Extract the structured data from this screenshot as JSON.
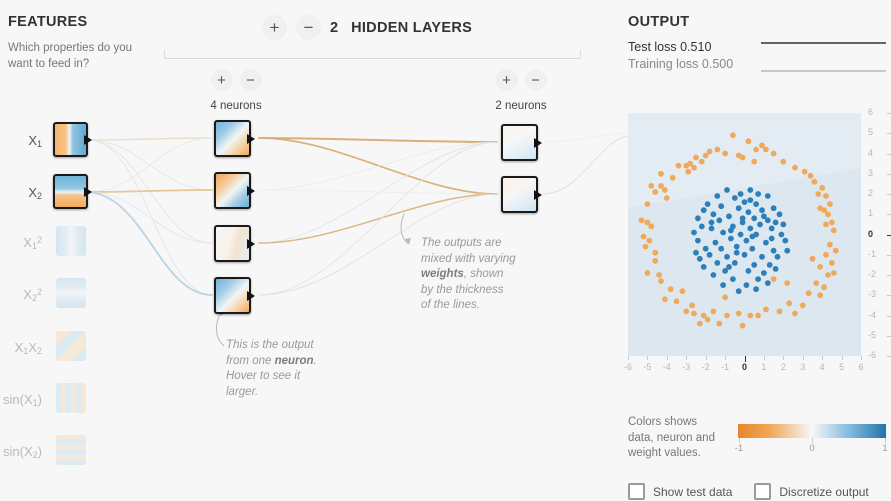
{
  "features": {
    "title": "FEATURES",
    "subtitle": "Which properties do you want to feed in?",
    "items": [
      {
        "label_html": "X₁",
        "base": "X",
        "sub": "1",
        "sup": "",
        "active": true,
        "name": "feature-x1"
      },
      {
        "label_html": "X₂",
        "base": "X",
        "sub": "2",
        "sup": "",
        "active": true,
        "name": "feature-x2"
      },
      {
        "label_html": "X₁²",
        "base": "X",
        "sub": "1",
        "sup": "2",
        "active": false,
        "name": "feature-x1-squared"
      },
      {
        "label_html": "X₂²",
        "base": "X",
        "sub": "2",
        "sup": "2",
        "active": false,
        "name": "feature-x2-squared"
      },
      {
        "label_html": "X₁X₂",
        "base": "X1X2",
        "sub": "",
        "sup": "",
        "active": false,
        "name": "feature-x1x2"
      },
      {
        "label_html": "sin(X₁)",
        "base": "sin(X",
        "sub": "1",
        "sup": "",
        "active": false,
        "name": "feature-sin-x1"
      },
      {
        "label_html": "sin(X₂)",
        "base": "sin(X",
        "sub": "2",
        "sup": "",
        "active": false,
        "name": "feature-sin-x2"
      }
    ]
  },
  "hidden_layers": {
    "count": "2",
    "title": "HIDDEN LAYERS",
    "add_label": "+",
    "remove_label": "−",
    "layers": [
      {
        "neuron_count_label": "4 neurons",
        "neurons": 4,
        "add_label": "+",
        "remove_label": "−"
      },
      {
        "neuron_count_label": "2 neurons",
        "neurons": 2,
        "add_label": "+",
        "remove_label": "−"
      }
    ]
  },
  "annotations": {
    "neuron": {
      "line1": "This is the output",
      "line2a": "from one ",
      "line2b": "neuron",
      "line2c": ".",
      "line3": "Hover to see it",
      "line4": "larger."
    },
    "weights": {
      "line1": "The outputs are",
      "line2": "mixed with varying",
      "line3a": "weights",
      "line3b": ", shown",
      "line4": "by the thickness",
      "line5": "of the lines."
    }
  },
  "output": {
    "title": "OUTPUT",
    "test_loss_label": "Test loss",
    "test_loss_value": "0.510",
    "training_loss_label": "Training loss",
    "training_loss_value": "0.500"
  },
  "legend": {
    "line1": "Colors shows",
    "line2": "data, neuron and",
    "line3": "weight values.",
    "ticks": [
      "-1",
      "0",
      "1"
    ]
  },
  "controls": {
    "show_test_data": "Show test data",
    "discretize_output": "Discretize output",
    "show_test_data_checked": false,
    "discretize_output_checked": false
  },
  "colors": {
    "negative": "#e8852a",
    "positive": "#2173a8",
    "neutral": "#f7f7f7",
    "plot_background": "#dce7ef",
    "text": "#333333",
    "muted": "#999999"
  },
  "chart_data": {
    "type": "scatter",
    "title": "OUTPUT",
    "xlabel": "",
    "ylabel": "",
    "xlim": [
      -6,
      6
    ],
    "ylim": [
      -6,
      6
    ],
    "xticks": [
      -6,
      -5,
      -4,
      -3,
      -2,
      -1,
      0,
      1,
      2,
      3,
      4,
      5,
      6
    ],
    "yticks": [
      -6,
      -5,
      -4,
      -3,
      -2,
      -1,
      0,
      1,
      2,
      3,
      4,
      5,
      6
    ],
    "grid": false,
    "legend": "none",
    "series": [
      {
        "name": "negative (orange ring)",
        "color": "#f0a95a",
        "points": [
          [
            -0.6,
            4.9
          ],
          [
            0.2,
            4.6
          ],
          [
            0.9,
            4.4
          ],
          [
            -1.8,
            4.1
          ],
          [
            -1.4,
            4.2
          ],
          [
            -1.0,
            4.0
          ],
          [
            -2.5,
            3.8
          ],
          [
            1.5,
            4.0
          ],
          [
            -0.3,
            3.9
          ],
          [
            -0.1,
            3.8
          ],
          [
            0.5,
            3.6
          ],
          [
            2.0,
            3.6
          ],
          [
            2.6,
            3.3
          ],
          [
            -3.4,
            3.4
          ],
          [
            -3.0,
            3.4
          ],
          [
            -2.8,
            3.5
          ],
          [
            -2.6,
            3.3
          ],
          [
            -2.9,
            3.1
          ],
          [
            -4.3,
            3.0
          ],
          [
            3.1,
            3.1
          ],
          [
            3.4,
            2.9
          ],
          [
            3.6,
            2.6
          ],
          [
            -4.8,
            2.4
          ],
          [
            -4.3,
            2.4
          ],
          [
            -4.1,
            2.2
          ],
          [
            -4.6,
            2.1
          ],
          [
            4.0,
            2.3
          ],
          [
            3.8,
            2.0
          ],
          [
            4.2,
            1.9
          ],
          [
            -5.0,
            1.5
          ],
          [
            4.4,
            1.5
          ],
          [
            3.9,
            1.3
          ],
          [
            4.1,
            1.2
          ],
          [
            4.3,
            1.0
          ],
          [
            -5.3,
            0.7
          ],
          [
            -5.0,
            0.6
          ],
          [
            -4.8,
            0.4
          ],
          [
            4.5,
            0.6
          ],
          [
            4.2,
            0.5
          ],
          [
            4.6,
            0.2
          ],
          [
            -5.2,
            -0.1
          ],
          [
            -4.9,
            -0.3
          ],
          [
            -5.1,
            -0.6
          ],
          [
            4.4,
            -0.5
          ],
          [
            4.7,
            -0.8
          ],
          [
            4.2,
            -1.0
          ],
          [
            -4.6,
            -1.3
          ],
          [
            4.5,
            -1.4
          ],
          [
            3.9,
            -1.6
          ],
          [
            -5.0,
            -1.9
          ],
          [
            4.3,
            -2.0
          ],
          [
            -4.3,
            -2.3
          ],
          [
            1.5,
            -2.2
          ],
          [
            2.2,
            -2.4
          ],
          [
            3.7,
            -2.4
          ],
          [
            4.1,
            -2.6
          ],
          [
            -3.8,
            -2.7
          ],
          [
            -3.2,
            -2.8
          ],
          [
            3.3,
            -2.9
          ],
          [
            3.9,
            -3.0
          ],
          [
            -4.1,
            -3.2
          ],
          [
            -3.5,
            -3.3
          ],
          [
            -1.0,
            -3.1
          ],
          [
            -2.7,
            -3.5
          ],
          [
            2.3,
            -3.4
          ],
          [
            3.0,
            -3.5
          ],
          [
            -3.0,
            -3.8
          ],
          [
            -2.6,
            -3.9
          ],
          [
            -1.6,
            -3.8
          ],
          [
            1.1,
            -3.7
          ],
          [
            1.8,
            -3.8
          ],
          [
            2.6,
            -3.9
          ],
          [
            -2.1,
            -4.0
          ],
          [
            -0.9,
            -4.0
          ],
          [
            -0.3,
            -3.9
          ],
          [
            0.3,
            -4.0
          ],
          [
            0.7,
            -4.0
          ],
          [
            -1.9,
            -4.2
          ],
          [
            -1.3,
            -4.4
          ],
          [
            -0.1,
            -4.5
          ],
          [
            -2.3,
            -4.4
          ],
          [
            -4.6,
            -0.9
          ],
          [
            -4.4,
            -2.0
          ],
          [
            -2.0,
            3.9
          ],
          [
            -3.7,
            2.8
          ],
          [
            3.5,
            -1.2
          ],
          [
            1.1,
            4.2
          ],
          [
            -2.2,
            3.6
          ],
          [
            0.6,
            4.2
          ],
          [
            -4.0,
            1.8
          ],
          [
            4.6,
            -1.9
          ]
        ]
      },
      {
        "name": "positive (blue center)",
        "color": "#2c7fb8",
        "points": [
          [
            -0.9,
            2.2
          ],
          [
            0.3,
            2.2
          ],
          [
            -1.4,
            1.9
          ],
          [
            1.2,
            1.9
          ],
          [
            -0.5,
            1.8
          ],
          [
            -1.9,
            1.5
          ],
          [
            0.0,
            1.6
          ],
          [
            0.6,
            1.5
          ],
          [
            -1.2,
            1.4
          ],
          [
            1.5,
            1.3
          ],
          [
            -2.1,
            1.2
          ],
          [
            -0.3,
            1.3
          ],
          [
            0.9,
            1.2
          ],
          [
            -1.6,
            1.0
          ],
          [
            0.2,
            1.1
          ],
          [
            1.8,
            1.0
          ],
          [
            -2.4,
            0.8
          ],
          [
            -0.8,
            0.9
          ],
          [
            0.5,
            0.8
          ],
          [
            1.2,
            0.7
          ],
          [
            -1.3,
            0.7
          ],
          [
            -0.1,
            0.6
          ],
          [
            0.8,
            0.5
          ],
          [
            2.0,
            0.5
          ],
          [
            -2.2,
            0.4
          ],
          [
            -1.7,
            0.3
          ],
          [
            -0.6,
            0.4
          ],
          [
            0.3,
            0.3
          ],
          [
            1.4,
            0.3
          ],
          [
            -2.6,
            0.1
          ],
          [
            -1.1,
            0.1
          ],
          [
            -0.2,
            0.0
          ],
          [
            0.6,
            0.0
          ],
          [
            1.9,
            0.0
          ],
          [
            -2.4,
            -0.3
          ],
          [
            -1.5,
            -0.4
          ],
          [
            -0.7,
            -0.2
          ],
          [
            0.1,
            -0.3
          ],
          [
            1.1,
            -0.4
          ],
          [
            2.1,
            -0.3
          ],
          [
            -2.0,
            -0.7
          ],
          [
            -1.2,
            -0.7
          ],
          [
            -0.4,
            -0.6
          ],
          [
            0.4,
            -0.7
          ],
          [
            1.5,
            -0.8
          ],
          [
            -2.5,
            -0.9
          ],
          [
            -1.8,
            -1.0
          ],
          [
            -0.9,
            -1.1
          ],
          [
            0.0,
            -1.0
          ],
          [
            0.9,
            -1.1
          ],
          [
            1.7,
            -1.1
          ],
          [
            -1.4,
            -1.4
          ],
          [
            -0.5,
            -1.4
          ],
          [
            0.5,
            -1.5
          ],
          [
            1.3,
            -1.5
          ],
          [
            -2.1,
            -1.6
          ],
          [
            -1.0,
            -1.8
          ],
          [
            0.2,
            -1.8
          ],
          [
            1.0,
            -1.9
          ],
          [
            1.6,
            -1.7
          ],
          [
            -1.6,
            -2.0
          ],
          [
            -0.6,
            -2.2
          ],
          [
            0.7,
            -2.2
          ],
          [
            -1.1,
            -2.5
          ],
          [
            0.1,
            -2.5
          ],
          [
            1.2,
            -2.4
          ],
          [
            -0.3,
            -2.8
          ],
          [
            0.6,
            -2.7
          ],
          [
            -0.8,
            -1.6
          ],
          [
            1.4,
            -0.2
          ],
          [
            -0.2,
            2.0
          ],
          [
            0.7,
            2.0
          ],
          [
            -1.7,
            0.6
          ],
          [
            1.6,
            0.6
          ],
          [
            -0.4,
            -0.9
          ],
          [
            0.3,
            1.7
          ],
          [
            -2.3,
            -1.2
          ],
          [
            2.2,
            -0.8
          ],
          [
            -0.1,
            0.8
          ],
          [
            0.4,
            -0.1
          ],
          [
            -0.7,
            0.2
          ],
          [
            1.0,
            0.9
          ]
        ]
      }
    ]
  }
}
